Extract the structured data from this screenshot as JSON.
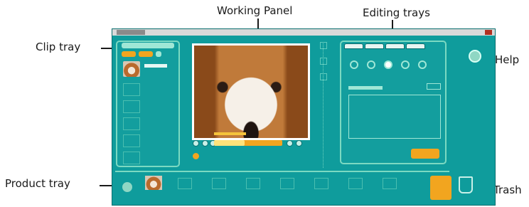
{
  "callouts": {
    "working_panel": "Working Panel",
    "editing_trays": "Editing trays",
    "clip_tray": "Clip tray",
    "help": "Help",
    "product_tray": "Product tray",
    "trash": "Trash"
  },
  "colors": {
    "app_bg": "#0f9c9c",
    "panel_border": "#7bd9c2",
    "accent": "#f2a51f"
  },
  "player": {
    "seek_progress": 0.45
  },
  "icons": {
    "help": "help-icon",
    "trash": "trash-icon",
    "film": "film-icon"
  }
}
